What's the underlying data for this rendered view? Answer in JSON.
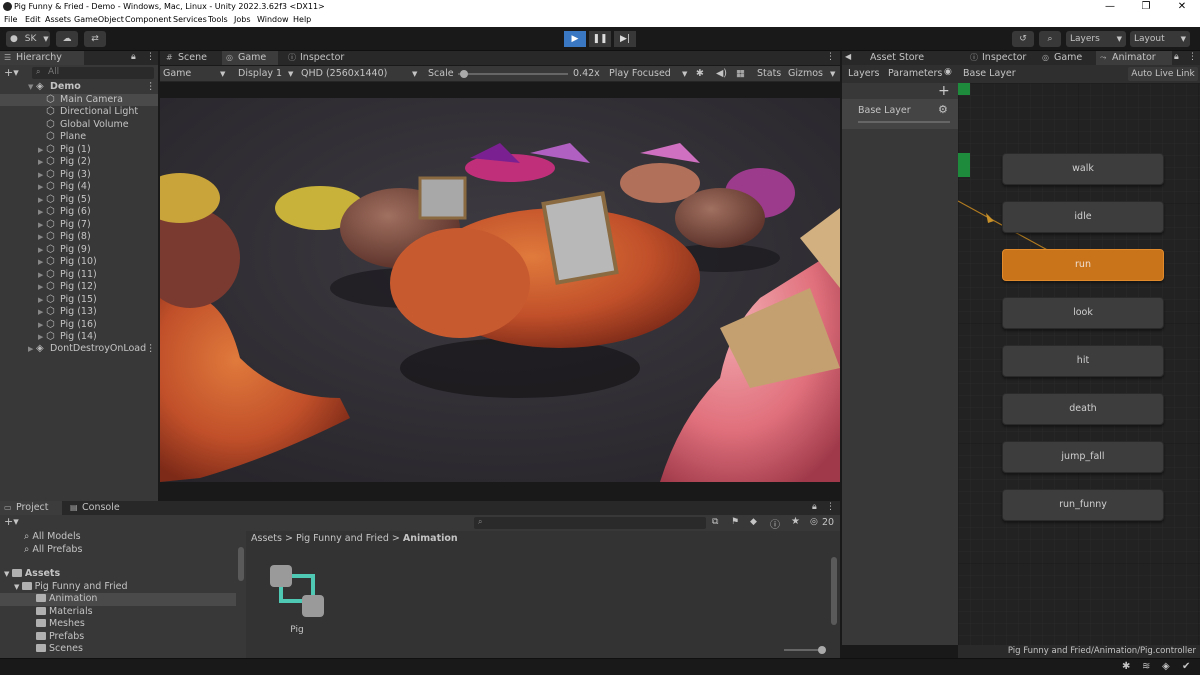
{
  "window": {
    "title": "Pig Funny & Fried - Demo - Windows, Mac, Linux - Unity 2022.3.62f3 <DX11>",
    "minimize": "—",
    "maximize": "❐",
    "close": "✕"
  },
  "menu": [
    "File",
    "Edit",
    "Assets",
    "GameObject",
    "Component",
    "Services",
    "Tools",
    "Jobs",
    "Window",
    "Help"
  ],
  "toolbar": {
    "account": "SK",
    "layers": "Layers",
    "layout": "Layout"
  },
  "tabs": {
    "hierarchy": "Hierarchy",
    "scene": "Scene",
    "game": "Game",
    "inspector": "Inspector",
    "asset_store_validator": "Asset Store Validator",
    "inspector2": "Inspector",
    "game2": "Game",
    "animator": "Animator",
    "project": "Project",
    "console": "Console"
  },
  "hierarchy": {
    "search_placeholder": "All",
    "scene": "Demo",
    "items": [
      "Main Camera",
      "Directional Light",
      "Global Volume",
      "Plane",
      "Pig (1)",
      "Pig (2)",
      "Pig (3)",
      "Pig (4)",
      "Pig (5)",
      "Pig (6)",
      "Pig (7)",
      "Pig (8)",
      "Pig (9)",
      "Pig (10)",
      "Pig (11)",
      "Pig (12)",
      "Pig (15)",
      "Pig (13)",
      "Pig (16)",
      "Pig (14)"
    ],
    "dont_destroy": "DontDestroyOnLoad"
  },
  "game_toolbar": {
    "mode": "Game",
    "display": "Display 1",
    "resolution": "QHD (2560x1440)",
    "scale_label": "Scale",
    "scale_value": "0.42x",
    "play_focused": "Play Focused",
    "stats": "Stats",
    "gizmos": "Gizmos",
    "scale_fraction": 0.02
  },
  "animator": {
    "layers_tab": "Layers",
    "parameters_tab": "Parameters",
    "breadcrumb": "Base Layer",
    "auto_live_link": "Auto Live Link",
    "layer_name": "Base Layer",
    "states": [
      "walk",
      "idle",
      "run",
      "look",
      "hit",
      "death",
      "jump_fall",
      "run_funny"
    ],
    "active_state": "run",
    "status_path": "Pig Funny and Fried/Animation/Pig.controller"
  },
  "project": {
    "favorites": [
      "All Models",
      "All Prefabs"
    ],
    "assets_root": "Assets",
    "tree": [
      "Pig Funny and Fried",
      "Animation",
      "Materials",
      "Meshes",
      "Prefabs",
      "Scenes"
    ],
    "breadcrumb": [
      "Assets",
      "Pig Funny and Fried",
      "Animation"
    ],
    "asset_name": "Pig",
    "hidden_count": "20"
  },
  "colors": {
    "run_state": "#c9731b",
    "play_accent": "#3a78c3",
    "entry_green": "#1e8a3c"
  }
}
